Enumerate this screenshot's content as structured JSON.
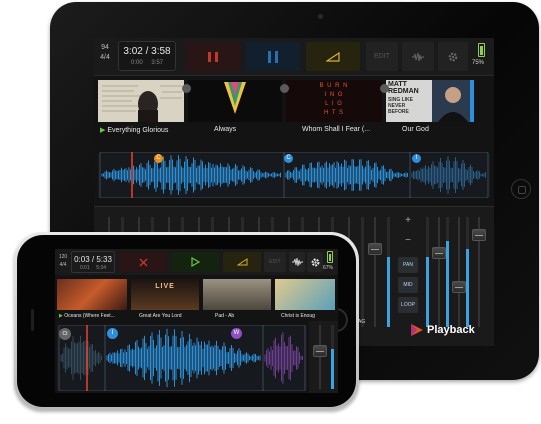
{
  "tablet": {
    "bpm": "94",
    "meter": "4/4",
    "time": "3:02 / 3:58",
    "time_sub_left": "0:00",
    "time_sub_right": "3:57",
    "edit_label": "EDIT",
    "battery_pct": "75%",
    "tracks": [
      {
        "title": "Everything Glorious",
        "playing": true
      },
      {
        "title": "Always",
        "playing": false
      },
      {
        "title": "Whom Shall I Fear (...",
        "playing": false
      },
      {
        "title": "Our God",
        "playing": false
      }
    ],
    "album_text_burning": [
      "B U R N",
      "I N G",
      "L I G",
      "H T S"
    ],
    "album_text_matt": [
      "MATT",
      "REDMAN",
      "SING LIKE",
      "NEVER",
      "BEFORE"
    ],
    "cue_markers": [
      "C",
      "C",
      "I"
    ],
    "mixer": {
      "pan_label": "PAN",
      "mid_label": "MID",
      "loop_label": "LOOP",
      "plus": "+",
      "minus": "−",
      "channel_label": "AG"
    },
    "brand": "Playback"
  },
  "phone": {
    "bpm": "120",
    "meter": "4/4",
    "time": "0:03 / 5:33",
    "time_sub_left": "0:01",
    "time_sub_right": "5:34",
    "edit_label": "EDIT",
    "battery_pct": "67%",
    "tracks": [
      {
        "title": "Oceans (Where Feet...",
        "playing": true
      },
      {
        "title": "Great Are You Lord",
        "playing": false
      },
      {
        "title": "Pad - Ab",
        "playing": false
      },
      {
        "title": "Christ is Enoug",
        "playing": false
      }
    ],
    "album_text_live": "LIVE",
    "cue_markers": [
      "Ct",
      "I",
      "W"
    ]
  },
  "colors": {
    "waveform": "#2a8fd6",
    "waveform_dim": "#3d4650",
    "playhead": "#e8452b",
    "accent_red": "#c0392b",
    "accent_blue": "#2a6fb0",
    "accent_yellow": "#d6b12e",
    "accent_green": "#6cc644",
    "battery": "#8fd14f",
    "cue_orange": "#e98a1b",
    "cue_blue": "#2f8fdc",
    "cue_purple": "#8e4fc4"
  }
}
